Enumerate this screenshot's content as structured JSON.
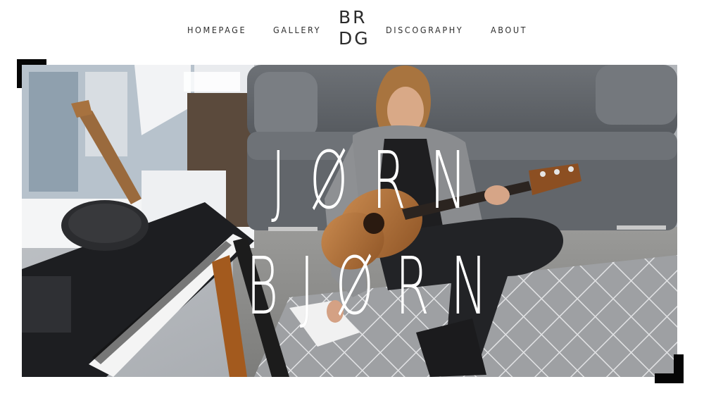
{
  "nav": {
    "items": [
      {
        "label": "HOMEPAGE"
      },
      {
        "label": "GALLERY"
      },
      {
        "label": "DISCOGRAPHY"
      },
      {
        "label": "ABOUT"
      }
    ],
    "logo": {
      "line1": "BR",
      "line2": "DG"
    }
  },
  "hero": {
    "title_line1": "JØRN",
    "title_line2": "BJØRN",
    "photo_subject": "musician playing acoustic guitar on a rug beside a keyboard and grey sofa"
  },
  "colors": {
    "text": "#2e2e2e",
    "corner_accent": "#050505",
    "hero_title": "#ffffff"
  }
}
